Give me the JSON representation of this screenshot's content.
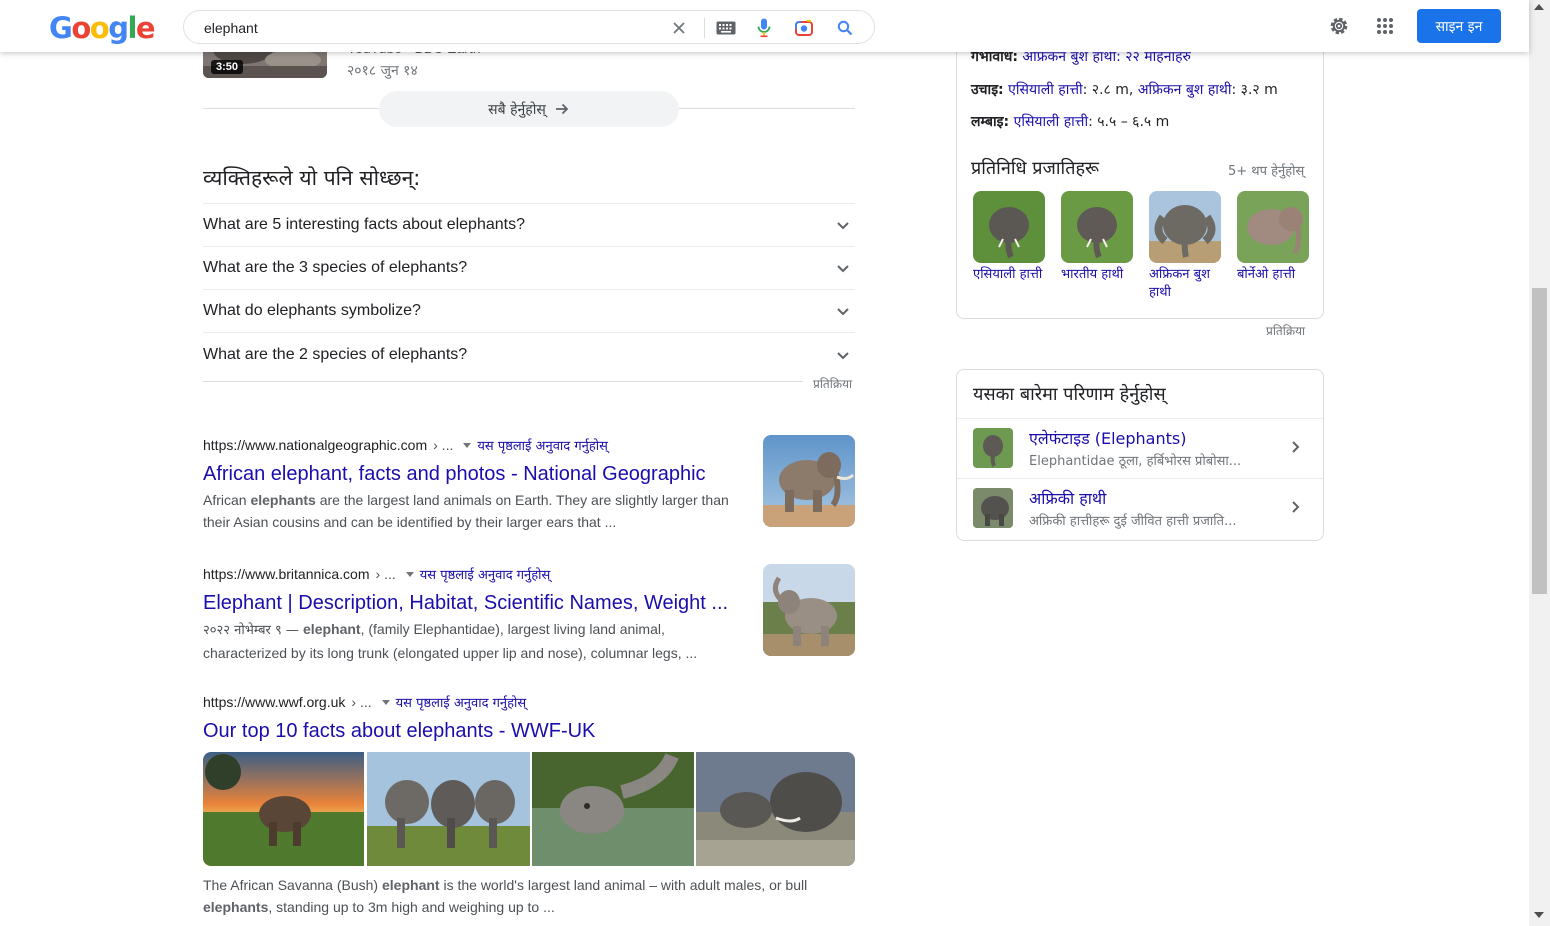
{
  "header": {
    "logo_letters": [
      "G",
      "o",
      "o",
      "g",
      "l",
      "e"
    ],
    "logo_colors": [
      "#4285F4",
      "#EA4335",
      "#FBBC05",
      "#4285F4",
      "#34A853",
      "#EA4335"
    ],
    "search_value": "elephant",
    "signin_label": "साइन इन"
  },
  "top_video": {
    "duration": "3:50",
    "source": "YouTube · BBC Earth",
    "date": "२०१८ जुन १४"
  },
  "view_all_label": "सबै हेर्नुहोस्",
  "people_also_ask": {
    "title": "व्यक्तिहरूले यो पनि सोध्छन्:",
    "questions": [
      "What are 5 interesting facts about elephants?",
      "What are the 3 species of elephants?",
      "What do elephants symbolize?",
      "What are the 2 species of elephants?"
    ],
    "feedback": "प्रतिक्रिया"
  },
  "results": [
    {
      "domain": "https://www.nationalgeographic.com",
      "path": "› ...",
      "translate": "यस पृष्ठलाई अनुवाद गर्नुहोस्",
      "title": "African elephant, facts and photos - National Geographic",
      "snippet_pre": "African ",
      "snippet_bold": "elephants",
      "snippet_post": " are the largest land animals on Earth. They are slightly larger than their Asian cousins and can be identified by their larger ears that ..."
    },
    {
      "domain": "https://www.britannica.com",
      "path": "› ...",
      "translate": "यस पृष्ठलाई अनुवाद गर्नुहोस्",
      "title": "Elephant | Description, Habitat, Scientific Names, Weight ...",
      "date": "२०२२ नोभेम्बर ९ — ",
      "snippet_bold": "elephant",
      "snippet_post": ", (family Elephantidae), largest living land animal, characterized by its long trunk (elongated upper lip and nose), columnar legs, ..."
    },
    {
      "domain": "https://www.wwf.org.uk",
      "path": "› ...",
      "translate": "यस पृष्ठलाई अनुवाद गर्नुहोस्",
      "title": "Our top 10 facts about elephants - WWF-UK",
      "snippet_pre": "The African Savanna (Bush) ",
      "snippet_bold": "elephant",
      "snippet_mid": " is the world's largest land animal – with adult males, or bull ",
      "snippet_bold2": "elephants",
      "snippet_post": ", standing up to 3m high and weighing up to ..."
    }
  ],
  "knowledge_panel": {
    "gestation_key": "गर्भावधि:",
    "gestation_value": "अफ्रिकन बुश हाथी: २२ महिनाहरु",
    "height_key": "उचाइ:",
    "height_a_name": "एसियाली हात्ती",
    "height_a_val": ": २.८ m,",
    "height_b_name": "अफ्रिकन बुश हाथी",
    "height_b_val": ": ३.२ m",
    "length_key": "लम्बाइ:",
    "length_a_name": "एसियाली हात्ती",
    "length_a_val": ": ५.५ – ६.५ m",
    "species_title": "प्रतिनिधि प्रजातिहरू",
    "species_more": "5+ थप हेर्नुहोस्",
    "species": [
      {
        "name": "एसियाली हात्ती"
      },
      {
        "name": "भारतीय हाथी"
      },
      {
        "name": "अफ्रिकन बुश हाथी"
      },
      {
        "name": "बोर्नेओ हात्ती"
      }
    ],
    "feedback": "प्रतिक्रिया"
  },
  "see_results": {
    "title": "यसका बारेमा परिणाम हेर्नुहोस्",
    "items": [
      {
        "name": "एलेफंटाइड (Elephants)",
        "desc": "Elephantidae ठूला, हर्बिभोरस प्रोबोसा..."
      },
      {
        "name": "अफ्रिकी हाथी",
        "desc": "अफ्रिकी हात्तीहरू दुई जीवित हात्ती प्रजाति..."
      }
    ]
  },
  "colors": {
    "link": "#1a0dab",
    "accent": "#1a73e8",
    "snippet": "#4d5156"
  }
}
